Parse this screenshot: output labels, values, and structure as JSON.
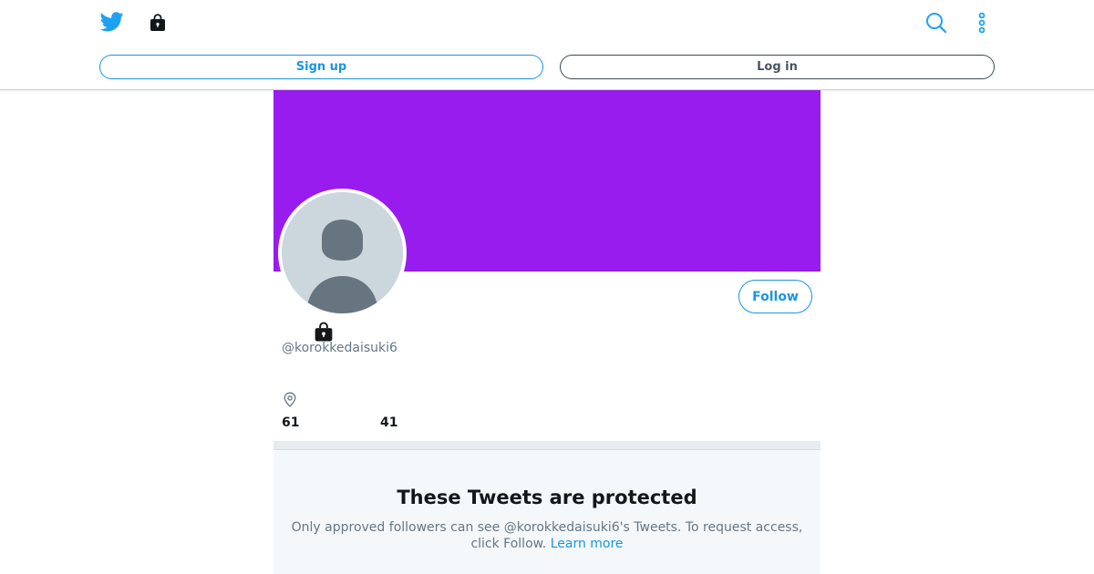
{
  "header": {
    "logo_icon": "twitter-bird-icon",
    "bag_icon": "shopping-bag-icon",
    "search_icon": "search-icon",
    "more_icon": "more-vertical-icon",
    "signup_label": "Sign up",
    "login_label": "Log in",
    "accent_color": "#1b95e0"
  },
  "profile": {
    "banner_color": "#981cee",
    "avatar_icon": "default-avatar-icon",
    "follow_label": "Follow",
    "protected_icon": "lock-icon",
    "handle": "@korokkedaisuki6",
    "location_icon": "location-pin-icon",
    "following_count": "61",
    "followers_count": "41"
  },
  "protected": {
    "title": "These Tweets are protected",
    "body": "Only approved followers can see @korokkedaisuki6's Tweets. To request access, click Follow.",
    "link": "Learn more"
  }
}
